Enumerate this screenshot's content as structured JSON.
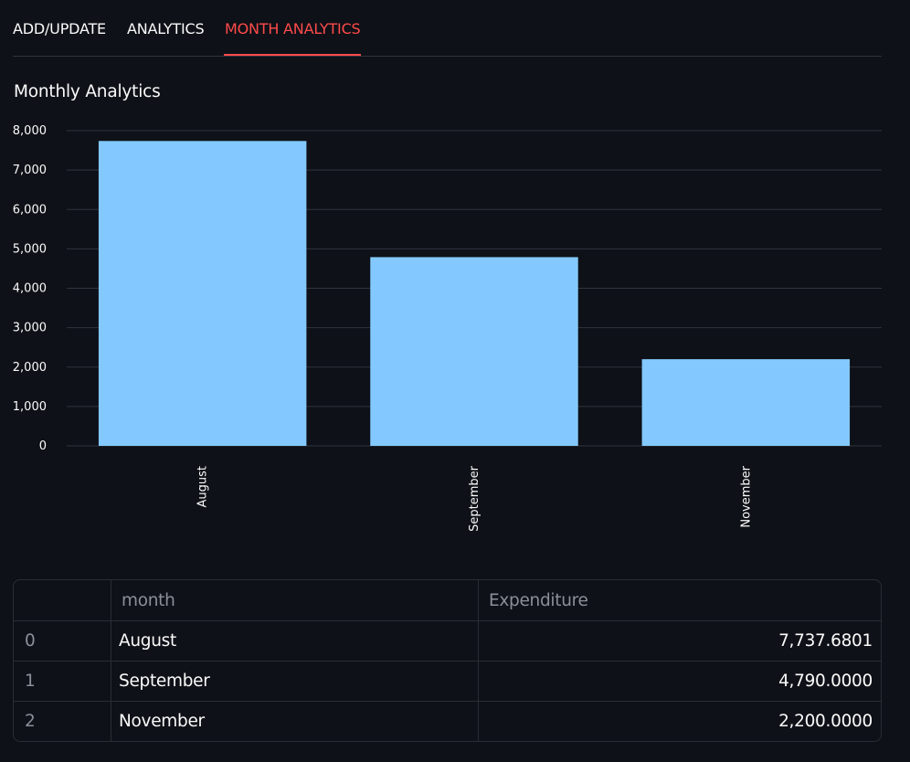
{
  "tabs": [
    {
      "label": "ADD/UPDATE",
      "active": false
    },
    {
      "label": "ANALYTICS",
      "active": false
    },
    {
      "label": "MONTH ANALYTICS",
      "active": true
    }
  ],
  "page_title": "Monthly Analytics",
  "chart_data": {
    "type": "bar",
    "categories": [
      "August",
      "September",
      "November"
    ],
    "values": [
      7737.6801,
      4790.0,
      2200.0
    ],
    "ylim": [
      0,
      8000
    ],
    "yticks": [
      0,
      1000,
      2000,
      3000,
      4000,
      5000,
      6000,
      7000,
      8000
    ],
    "ytick_labels": [
      "0",
      "1,000",
      "2,000",
      "3,000",
      "4,000",
      "5,000",
      "6,000",
      "7,000",
      "8,000"
    ],
    "grid": true,
    "xlabel": "",
    "ylabel": "",
    "color": "#83c9ff"
  },
  "table": {
    "columns": [
      "",
      "month",
      "Expenditure"
    ],
    "rows": [
      {
        "index": "0",
        "month": "August",
        "expenditure": "7,737.6801"
      },
      {
        "index": "1",
        "month": "September",
        "expenditure": "4,790.0000"
      },
      {
        "index": "2",
        "month": "November",
        "expenditure": "2,200.0000"
      }
    ]
  },
  "colors": {
    "background": "#0e1117",
    "accent": "#ff4b4b",
    "bar": "#83c9ff",
    "text": "#fafafa",
    "muted_text": "#8c8f99"
  }
}
